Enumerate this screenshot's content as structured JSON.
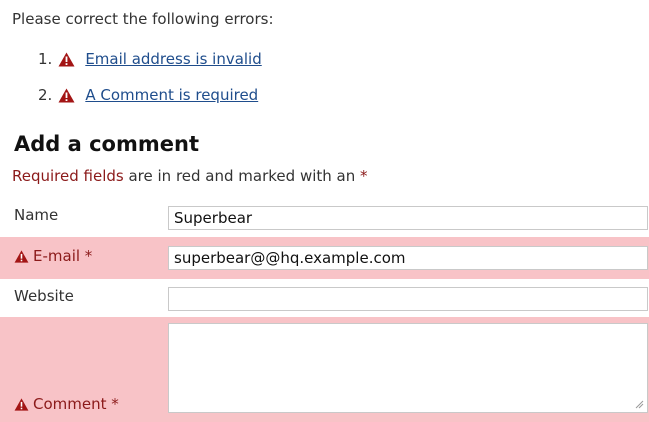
{
  "intro": "Please correct the following errors:",
  "errors": [
    {
      "num": "1.",
      "text": "Email address is invalid"
    },
    {
      "num": "2.",
      "text": "A Comment is required"
    }
  ],
  "heading": "Add a comment",
  "required_note": {
    "red_part": "Required fields",
    "rest": " are in red and marked with an ",
    "asterisk": "*"
  },
  "form": {
    "name": {
      "label": "Name",
      "value": "Superbear"
    },
    "email": {
      "label": "E-mail *",
      "value": "superbear@@hq.example.com"
    },
    "website": {
      "label": "Website",
      "value": ""
    },
    "comment": {
      "label": "Comment *",
      "value": ""
    }
  },
  "colors": {
    "error_bg": "#f8c3c7",
    "error_text": "#8b1a1a",
    "link": "#1f4d8c",
    "warning_icon": "#a31515"
  },
  "icons": {
    "warning": "warning-triangle-icon",
    "resize": "resize-grip-icon"
  }
}
